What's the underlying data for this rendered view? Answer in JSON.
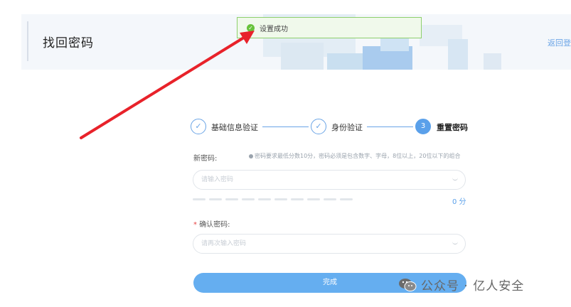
{
  "header": {
    "title": "找回密码",
    "back_link": "返回登"
  },
  "toast": {
    "message": "设置成功",
    "icon": "check-circle-icon"
  },
  "steps": [
    {
      "label": "基础信息验证",
      "status": "done"
    },
    {
      "label": "身份验证",
      "status": "done"
    },
    {
      "number": "3",
      "label": "重置密码",
      "status": "active"
    }
  ],
  "form": {
    "new_password": {
      "label": "新密码:",
      "hint": "密码要求最低分数10分，密码必须是包含数字、字母，8位以上，20位以下的组合",
      "placeholder": "请输入密码"
    },
    "strength": {
      "segments": 10,
      "score_text": "0 分"
    },
    "confirm_password": {
      "required_mark": "*",
      "label": "确认密码:",
      "placeholder": "请再次输入密码"
    },
    "submit_label": "完成"
  },
  "watermark": {
    "text": "公众号 · 亿人安全"
  },
  "colors": {
    "accent": "#5aa0ea",
    "success": "#67c23a",
    "arrow": "#e8222a"
  }
}
